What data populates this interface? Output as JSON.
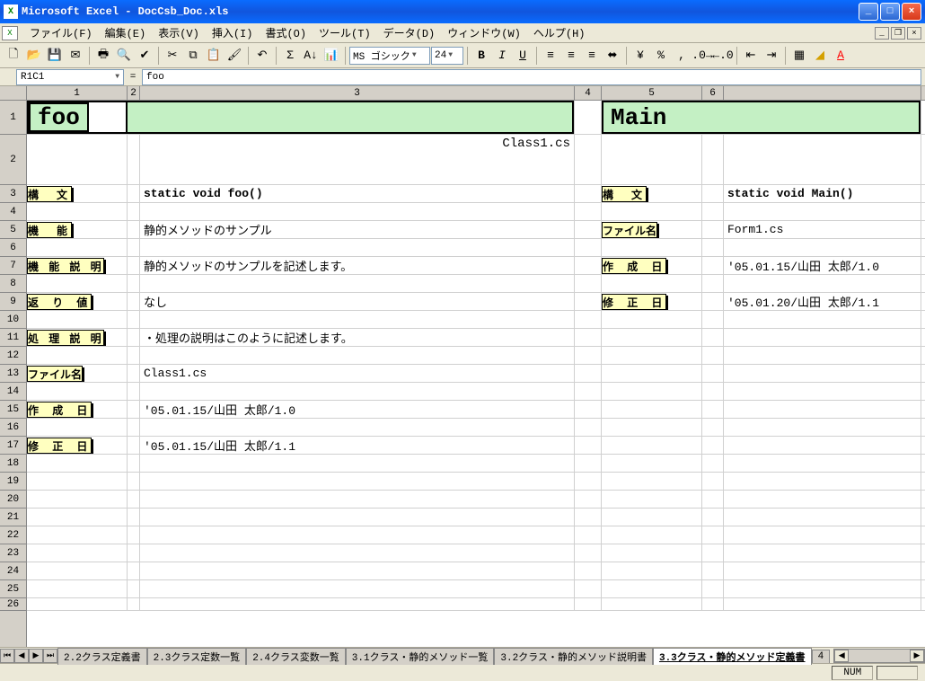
{
  "titlebar": {
    "text": "Microsoft Excel - DocCsb_Doc.xls"
  },
  "menus": [
    "ファイル(F)",
    "編集(E)",
    "表示(V)",
    "挿入(I)",
    "書式(O)",
    "ツール(T)",
    "データ(D)",
    "ウィンドウ(W)",
    "ヘルプ(H)"
  ],
  "toolbar": {
    "font_name": "MS ゴシック",
    "font_size": "24"
  },
  "namebox": "R1C1",
  "formula": "foo",
  "columns": [
    "1",
    "2",
    "3",
    "4",
    "5",
    "6"
  ],
  "row_numbers": [
    "1",
    "2",
    "3",
    "4",
    "5",
    "6",
    "7",
    "8",
    "9",
    "10",
    "11",
    "12",
    "13",
    "14",
    "15",
    "16",
    "17",
    "18",
    "19",
    "20",
    "21",
    "22",
    "23",
    "24",
    "25",
    "26"
  ],
  "sheet_left": {
    "title": "foo",
    "class_file": "Class1.cs",
    "labels": {
      "kobun": "構　文",
      "kinou": "機　能",
      "kinou_setsumei": "機 能 説 明",
      "kaerichi": "返 り 値",
      "shori_setsumei": "処 理 説 明",
      "file_mei": "ファイル名",
      "sakusei_bi": "作 成 日",
      "shusei_bi": "修 正 日"
    },
    "values": {
      "kobun": "static void foo()",
      "kinou": "静的メソッドのサンプル",
      "kinou_setsumei": "静的メソッドのサンプルを記述します。",
      "kaerichi": "なし",
      "shori_setsumei": "・処理の説明はこのように記述します。",
      "file_mei": "Class1.cs",
      "sakusei_bi": "'05.01.15/山田 太郎/1.0",
      "shusei_bi": "'05.01.15/山田 太郎/1.1"
    }
  },
  "sheet_right": {
    "title": "Main",
    "labels": {
      "kobun": "構　文",
      "file_mei": "ファイル名",
      "sakusei_bi": "作 成 日",
      "shusei_bi": "修 正 日"
    },
    "values": {
      "kobun": "static void Main()",
      "file_mei": "Form1.cs",
      "sakusei_bi": "'05.01.15/山田 太郎/1.0",
      "shusei_bi": "'05.01.20/山田 太郎/1.1"
    }
  },
  "tabs": {
    "items": [
      "2.2クラス定義書",
      "2.3クラス定数一覧",
      "2.4クラス変数一覧",
      "3.1クラス・静的メソッド一覧",
      "3.2クラス・静的メソッド説明書",
      "3.3クラス・静的メソッド定義書",
      "4"
    ],
    "active_index": 5
  },
  "statusbar": {
    "num": "NUM"
  }
}
